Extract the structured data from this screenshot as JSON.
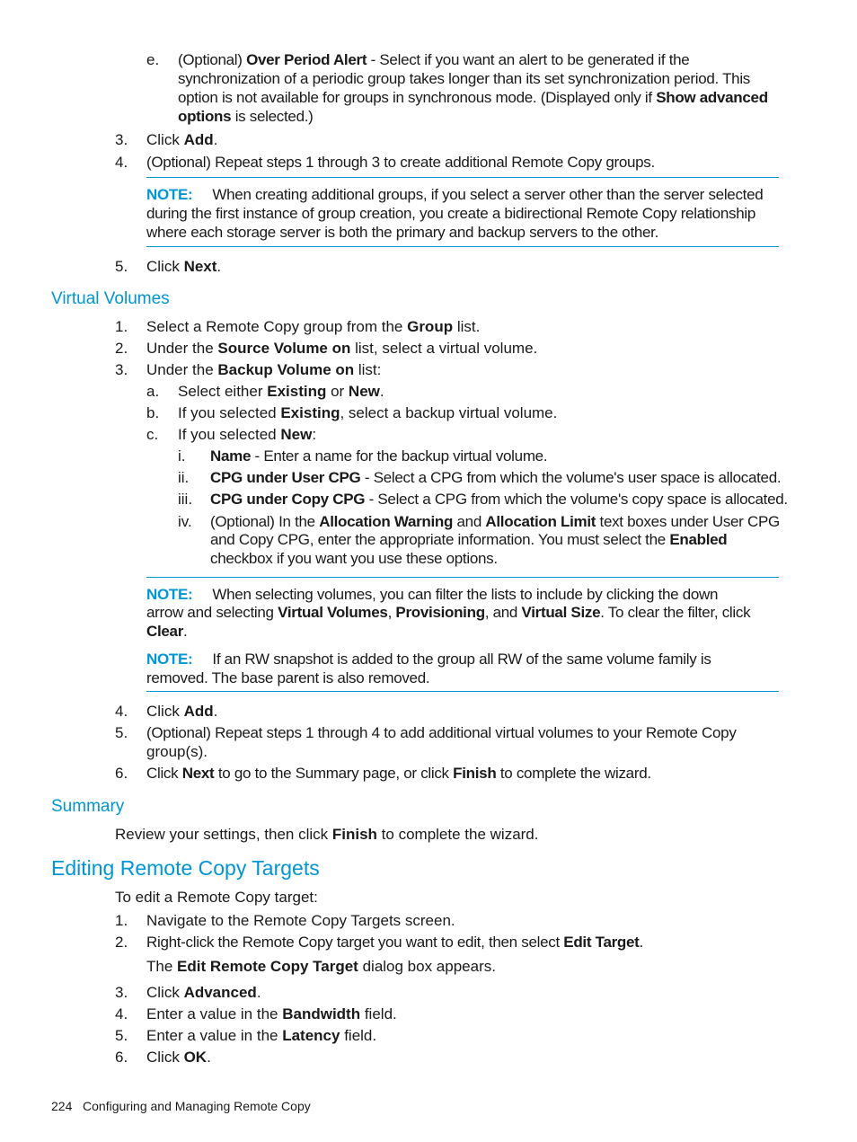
{
  "colors": {
    "accent": "#0096d6",
    "text": "#1a1a1a"
  },
  "top_list": {
    "item_e": {
      "marker": "e.",
      "lines": [
        [
          "(Optional) ",
          {
            "b": "Over Period Alert"
          },
          " - Select if you want an alert to be generated if the"
        ],
        [
          "synchronization of a periodic group takes longer than its set synchronization period. This"
        ],
        [
          "option is not available for groups in synchronous mode. (Displayed only if ",
          {
            "b": "Show advanced"
          }
        ],
        [
          {
            "b": "options"
          },
          " is selected.)"
        ]
      ]
    },
    "step3": {
      "marker": "3.",
      "text_pre": "Click ",
      "bold": "Add",
      "text_post": "."
    },
    "step4": {
      "marker": "4.",
      "text": "(Optional) Repeat steps 1 through 3 to create additional Remote Copy groups."
    },
    "note": {
      "label": "NOTE:",
      "lines": [
        "When creating additional groups, if you select a server other than the server selected",
        "during the first instance of group creation, you create a bidirectional Remote Copy relationship",
        "where each storage server is both the primary and backup servers to the other."
      ]
    },
    "step5": {
      "marker": "5.",
      "text_pre": "Click ",
      "bold": "Next",
      "text_post": "."
    }
  },
  "virtual_volumes": {
    "heading": "Virtual Volumes",
    "steps": [
      {
        "marker": "1.",
        "parts": [
          "Select a Remote Copy group from the ",
          {
            "b": "Group"
          },
          " list."
        ]
      },
      {
        "marker": "2.",
        "parts": [
          "Under the ",
          {
            "b": "Source Volume on"
          },
          " list, select a virtual volume."
        ]
      },
      {
        "marker": "3.",
        "parts": [
          "Under the ",
          {
            "b": "Backup Volume on"
          },
          " list:"
        ]
      }
    ],
    "substeps": [
      {
        "marker": "a.",
        "parts": [
          "Select either ",
          {
            "b": "Existing"
          },
          " or ",
          {
            "b": "New"
          },
          "."
        ]
      },
      {
        "marker": "b.",
        "parts": [
          "If you selected ",
          {
            "b": "Existing"
          },
          ", select a backup virtual volume."
        ]
      },
      {
        "marker": "c.",
        "parts": [
          "If you selected ",
          {
            "b": "New"
          },
          ":"
        ]
      }
    ],
    "roman": [
      {
        "marker": "i.",
        "lines": [
          [
            {
              "b": "Name"
            },
            " - Enter a name for the backup virtual volume."
          ]
        ]
      },
      {
        "marker": "ii.",
        "lines": [
          [
            {
              "b": "CPG under User CPG"
            },
            " - Select a CPG from which the volume's user space is allocated."
          ]
        ]
      },
      {
        "marker": "iii.",
        "lines": [
          [
            {
              "b": "CPG under Copy CPG"
            },
            " - Select a CPG from which the volume's copy space is allocated."
          ]
        ]
      },
      {
        "marker": "iv.",
        "lines": [
          [
            "(Optional) In the ",
            {
              "b": "Allocation Warning"
            },
            " and ",
            {
              "b": "Allocation Limit"
            },
            " text boxes under User CPG"
          ],
          [
            "and Copy CPG, enter the appropriate information. You must select the ",
            {
              "b": "Enabled"
            }
          ],
          [
            "checkbox if you want you use these options."
          ]
        ]
      }
    ],
    "notes": [
      {
        "label": "NOTE:",
        "lines": [
          [
            "When selecting volumes, you can filter the lists to include by clicking the down"
          ],
          [
            "arrow and selecting ",
            {
              "b": "Virtual Volumes"
            },
            ", ",
            {
              "b": "Provisioning"
            },
            ", and ",
            {
              "b": "Virtual Size"
            },
            ". To clear the filter, click"
          ],
          [
            {
              "b": "Clear"
            },
            "."
          ]
        ]
      },
      {
        "label": "NOTE:",
        "lines": [
          [
            "If an RW snapshot is added to the group all RW of the same volume family is"
          ],
          [
            "removed. The base parent is also removed."
          ]
        ]
      }
    ],
    "steps_after": [
      {
        "marker": "4.",
        "lines": [
          [
            "Click ",
            {
              "b": "Add"
            },
            "."
          ]
        ]
      },
      {
        "marker": "5.",
        "lines": [
          [
            "(Optional) Repeat steps 1 through 4 to add additional virtual volumes to your Remote Copy"
          ],
          [
            "group(s)."
          ]
        ]
      },
      {
        "marker": "6.",
        "lines": [
          [
            "Click ",
            {
              "b": "Next"
            },
            " to go to the Summary page, or click ",
            {
              "b": "Finish"
            },
            " to complete the wizard."
          ]
        ]
      }
    ]
  },
  "summary": {
    "heading": "Summary",
    "parts": [
      "Review your settings, then click ",
      {
        "b": "Finish"
      },
      " to complete the wizard."
    ]
  },
  "editing": {
    "heading": "Editing Remote Copy Targets",
    "intro": "To edit a Remote Copy target:",
    "steps": [
      {
        "marker": "1.",
        "parts": [
          "Navigate to the Remote Copy Targets screen."
        ]
      },
      {
        "marker": "2.",
        "parts": [
          "Right-click the Remote Copy target you want to edit, then select ",
          {
            "b": "Edit Target"
          },
          "."
        ]
      },
      {
        "marker": "",
        "parts": [
          "The ",
          {
            "b": "Edit Remote Copy Target"
          },
          " dialog box appears."
        ]
      },
      {
        "marker": "3.",
        "parts": [
          "Click ",
          {
            "b": "Advanced"
          },
          "."
        ]
      },
      {
        "marker": "4.",
        "parts": [
          "Enter a value in the ",
          {
            "b": "Bandwidth"
          },
          " field."
        ]
      },
      {
        "marker": "5.",
        "parts": [
          "Enter a value in the ",
          {
            "b": "Latency"
          },
          " field."
        ]
      },
      {
        "marker": "6.",
        "parts": [
          "Click ",
          {
            "b": "OK"
          },
          "."
        ]
      }
    ]
  },
  "footer": {
    "page_number": "224",
    "chapter": "Configuring and Managing Remote Copy"
  }
}
